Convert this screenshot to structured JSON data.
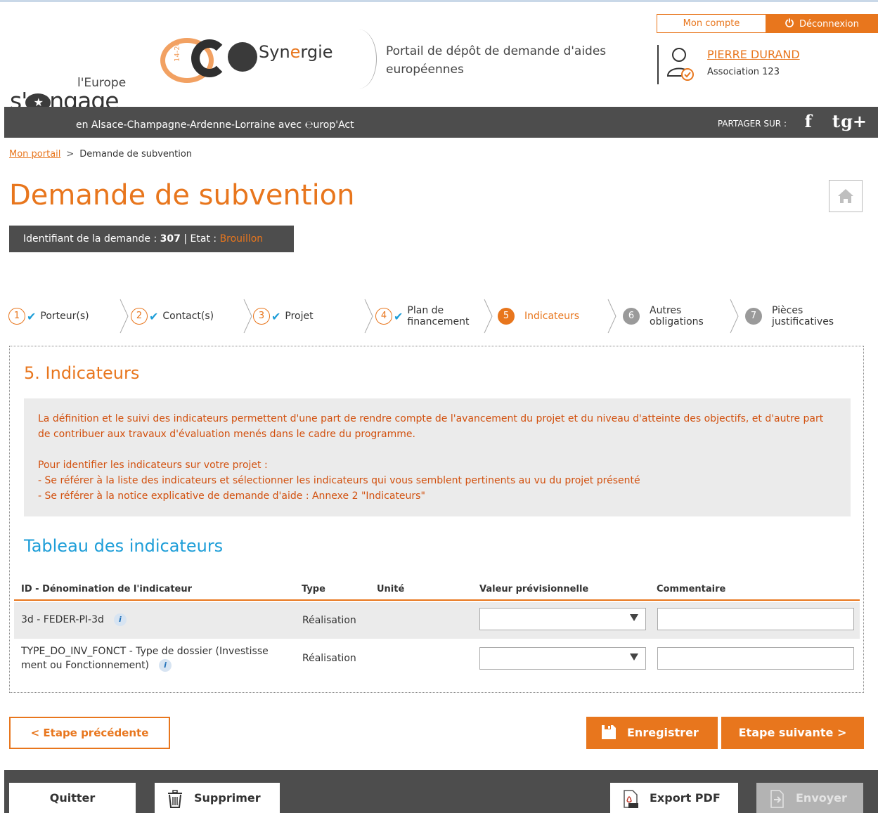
{
  "header": {
    "brand_europe": "l'Europe",
    "brand_engage_pre": "s'",
    "brand_engage_post": "ngage",
    "synergie_period": "14-20",
    "synergie_name_pre": "Syn",
    "synergie_name_o": "e",
    "synergie_name_post": "rgie",
    "portal_text": "Portail de dépôt de demande d'aides européennes",
    "account_label": "Mon compte",
    "logout_label": "Déconnexion",
    "user_name": "PIERRE DURAND",
    "user_org": "Association 123",
    "region_text": "en Alsace-Champagne-Ardenne-Lorraine avec ℮urop'Act",
    "share_label": "PARTAGER SUR :",
    "social": [
      "f",
      "t",
      "g+"
    ]
  },
  "breadcrumb": {
    "home": "Mon portail",
    "separator": ">",
    "current": "Demande de subvention"
  },
  "page": {
    "title": "Demande de subvention",
    "id_label": "Identifiant de la demande :",
    "id_value": "307",
    "pipe": "|",
    "state_label": "Etat :",
    "state_value": "Brouillon"
  },
  "steps": [
    {
      "num": "1",
      "label": "Porteur(s)",
      "label2": "",
      "status": "done"
    },
    {
      "num": "2",
      "label": "Contact(s)",
      "label2": "",
      "status": "done"
    },
    {
      "num": "3",
      "label": "Projet",
      "label2": "",
      "status": "done"
    },
    {
      "num": "4",
      "label": "Plan de",
      "label2": "financement",
      "status": "done"
    },
    {
      "num": "5",
      "label": "Indicateurs",
      "label2": "",
      "status": "active"
    },
    {
      "num": "6",
      "label": "Autres",
      "label2": "obligations",
      "status": "todo"
    },
    {
      "num": "7",
      "label": "Pièces",
      "label2": "justificatives",
      "status": "todo"
    }
  ],
  "section": {
    "title": "5. Indicateurs",
    "info_p1": "La définition et le suivi des indicateurs permettent d'une part de rendre compte de l'avancement du projet et du niveau d'atteinte des objectifs, et d'autre part de contribuer aux travaux d'évaluation menés dans le cadre du programme.",
    "info_p2": "Pour identifier les indicateurs sur votre projet :",
    "info_p3": "- Se référer à la liste des indicateurs et sélectionner les indicateurs qui vous semblent pertinents au vu du projet présenté",
    "info_p4": "- Se référer à la notice explicative de demande d'aide : Annexe 2 \"Indicateurs\"",
    "table_title": "Tableau des indicateurs"
  },
  "table": {
    "columns": [
      "ID - Dénomination de l'indicateur",
      "Type",
      "Unité",
      "Valeur prévisionnelle",
      "Commentaire"
    ],
    "rows": [
      {
        "name": "3d - FEDER-PI-3d",
        "name2": "",
        "type": "Réalisation",
        "unit": "",
        "value": "",
        "comment": ""
      },
      {
        "name": "TYPE_DO_INV_FONCT - Type de dossier (Investisse",
        "name2": "ment ou Fonctionnement)",
        "type": "Réalisation",
        "unit": "",
        "value": "",
        "comment": ""
      }
    ],
    "info_glyph": "i"
  },
  "nav": {
    "prev": "< Etape précédente",
    "save": "Enregistrer",
    "next": "Etape suivante >"
  },
  "footer": {
    "quit": "Quitter",
    "delete": "Supprimer",
    "export": "Export PDF",
    "send": "Envoyer"
  },
  "colors": {
    "accent": "#e8761d",
    "link_blue": "#1e9ed8",
    "dark_bar": "#4d4d4d",
    "info_text": "#d2510f"
  }
}
